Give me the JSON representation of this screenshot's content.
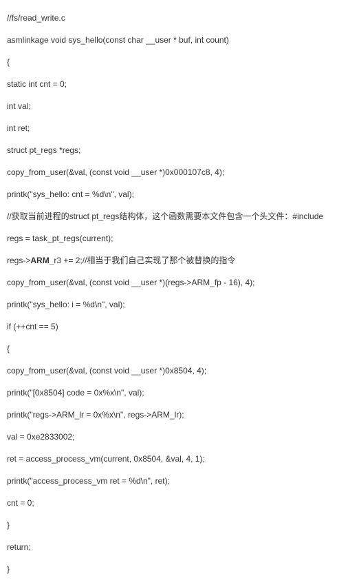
{
  "domain": "Document",
  "description": "C source code snippet from //fs/read_write.c showing sys_hello function implementation",
  "code_lines": [
    "//fs/read_write.c",
    "asmlinkage void sys_hello(const char __user * buf, int count)",
    "{",
    "static int cnt = 0;",
    "int val;",
    "int ret;",
    "struct pt_regs *regs;",
    "copy_from_user(&val, (const void __user *)0x000107c8, 4);",
    "printk(\"sys_hello: cnt = %d\\n\", val);",
    "//获取当前进程的struct pt_regs结构体，这个函数需要本文件包含一个头文件：#include",
    "regs = task_pt_regs(current);",
    "",
    "copy_from_user(&val, (const void __user *)(regs->ARM_fp - 16), 4);",
    "printk(\"sys_hello: i = %d\\n\", val);",
    "if (++cnt == 5)",
    "{",
    "copy_from_user(&val, (const void __user *)0x8504, 4);",
    "printk(\"[0x8504] code = 0x%x\\n\", val);",
    "printk(\"regs->ARM_lr  = 0x%x\\n\", regs->ARM_lr);",
    "val = 0xe2833002;",
    "ret = access_process_vm(current, 0x8504, &val, 4, 1);",
    "printk(\"access_process_vm ret = %d\\n\", ret);",
    "cnt = 0;",
    "}",
    "return;",
    "}"
  ],
  "special_line_12": {
    "prefix": "regs->",
    "bold": "ARM_",
    "suffix": "r3 += 2;//相当于我们自己实现了那个被替换的指令"
  }
}
